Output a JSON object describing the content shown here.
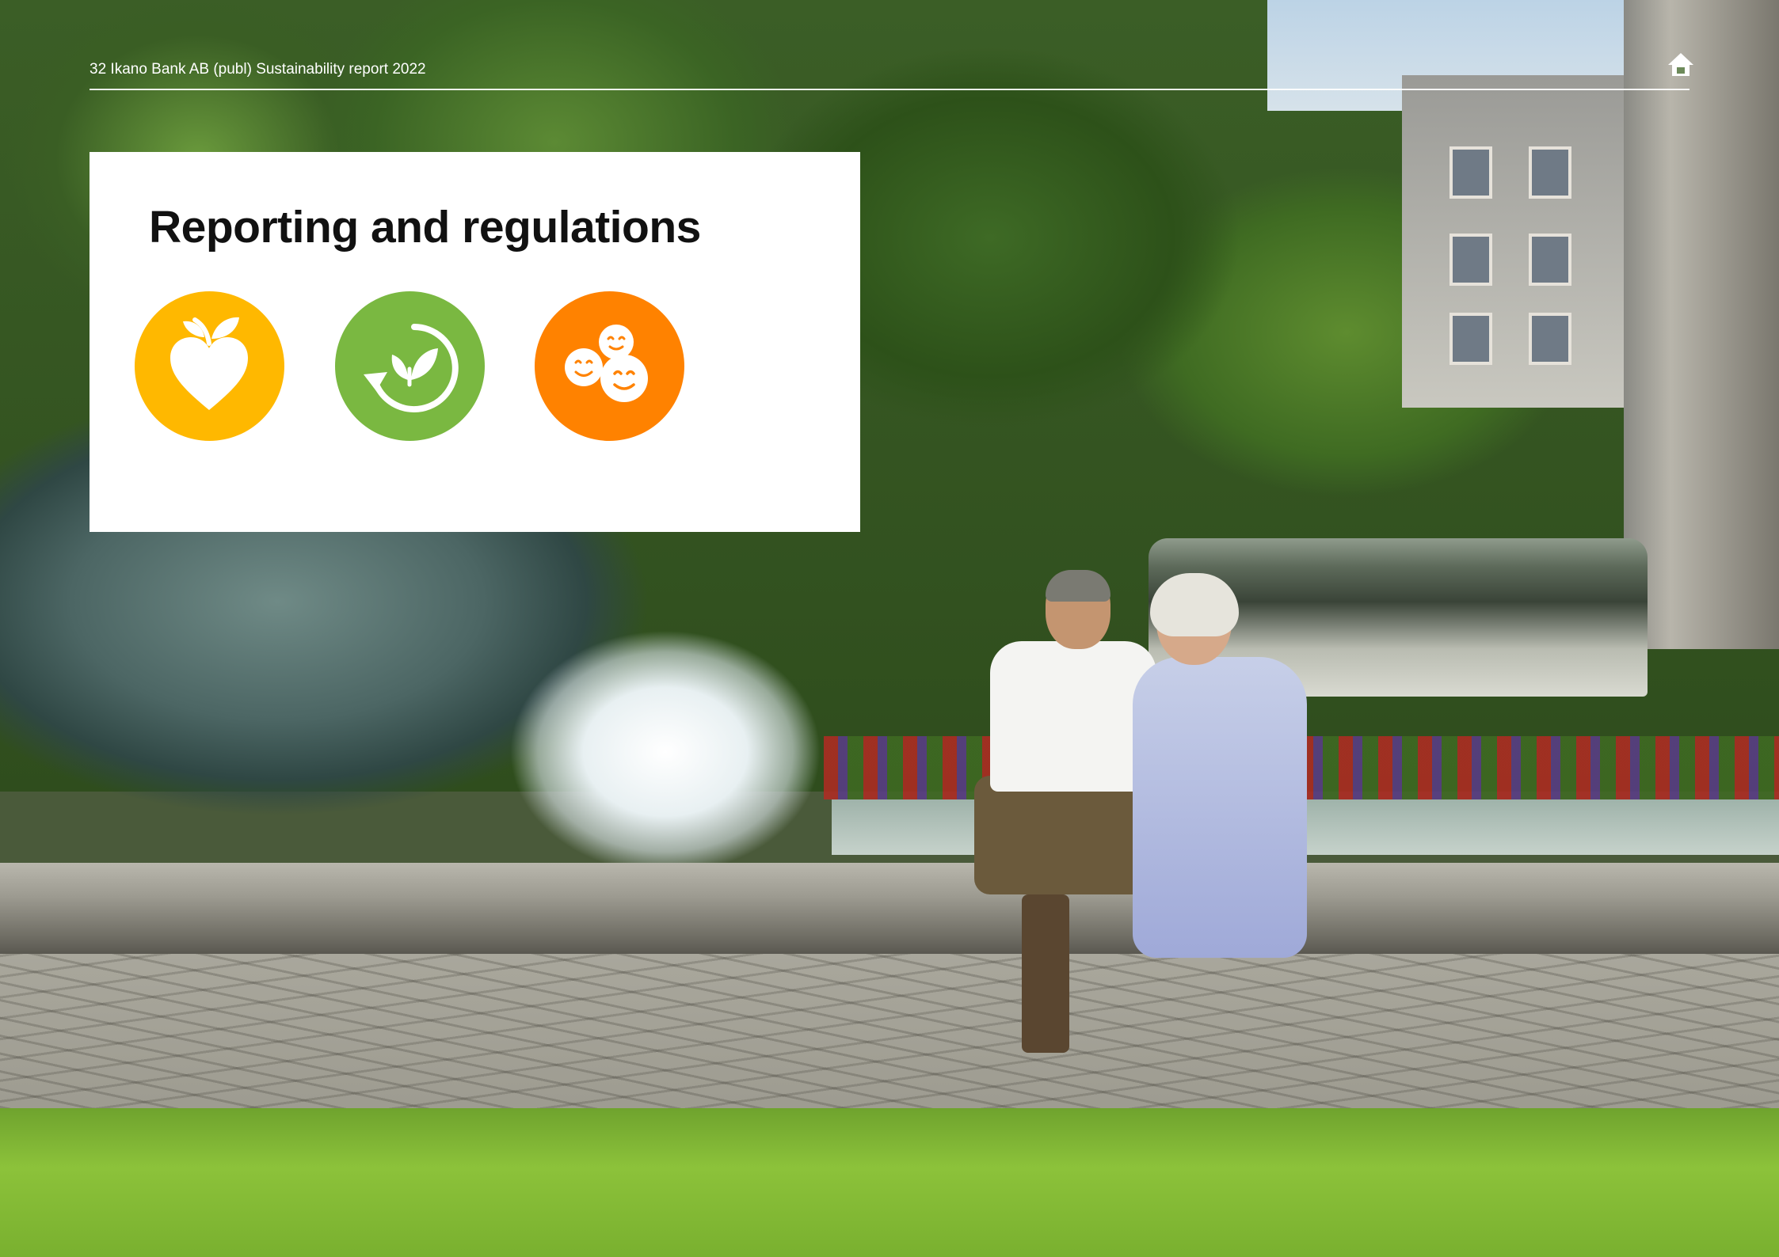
{
  "header": {
    "page_label": "32 Ikano Bank AB (publ) Sustainability report 2022"
  },
  "panel": {
    "title": "Reporting and regulations"
  },
  "icons": {
    "home": "home-icon",
    "health": "heart-with-leaf-icon",
    "environment": "leaf-cycle-icon",
    "people": "smiling-faces-icon"
  },
  "colors": {
    "health_badge": "#FFB800",
    "environment_badge": "#7AB841",
    "people_badge": "#FF8200",
    "panel_background": "#FFFFFF",
    "header_text": "#FFFFFF"
  }
}
